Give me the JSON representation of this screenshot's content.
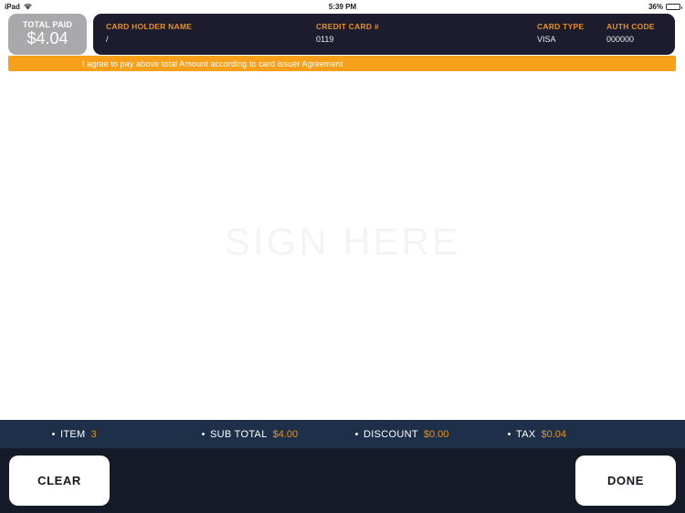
{
  "status_bar": {
    "device": "iPad",
    "wifi_icon": "wifi-icon",
    "time": "5:39 PM",
    "battery_percent": "36%",
    "battery_level": 36
  },
  "header": {
    "total_paid": {
      "label": "TOTAL PAID",
      "value": "$4.04"
    },
    "card_fields": [
      {
        "label": "CARD HOLDER NAME",
        "value": "/"
      },
      {
        "label": "CREDIT CARD #",
        "value": "0119"
      },
      {
        "label": "CARD TYPE",
        "value": "VISA"
      },
      {
        "label": "AUTH CODE",
        "value": "000000"
      }
    ]
  },
  "agreement": {
    "text": "I agree to pay above total Amount according to card issuer Agreement",
    "color": "#f9a01b"
  },
  "signature": {
    "placeholder": "SIGN HERE"
  },
  "totals": [
    {
      "label": "ITEM",
      "value": "3"
    },
    {
      "label": "SUB TOTAL",
      "value": "$4.00"
    },
    {
      "label": "DISCOUNT",
      "value": "$0.00"
    },
    {
      "label": "TAX",
      "value": "$0.04"
    }
  ],
  "footer": {
    "clear_label": "CLEAR",
    "done_label": "DONE"
  },
  "colors": {
    "accent_orange": "#e8911c",
    "agreement_orange": "#f9a01b",
    "card_panel": "#1d1c2f",
    "totals_bar": "#1e3049",
    "footer": "#141a27",
    "total_paid_btn": "#a9a9ab"
  }
}
